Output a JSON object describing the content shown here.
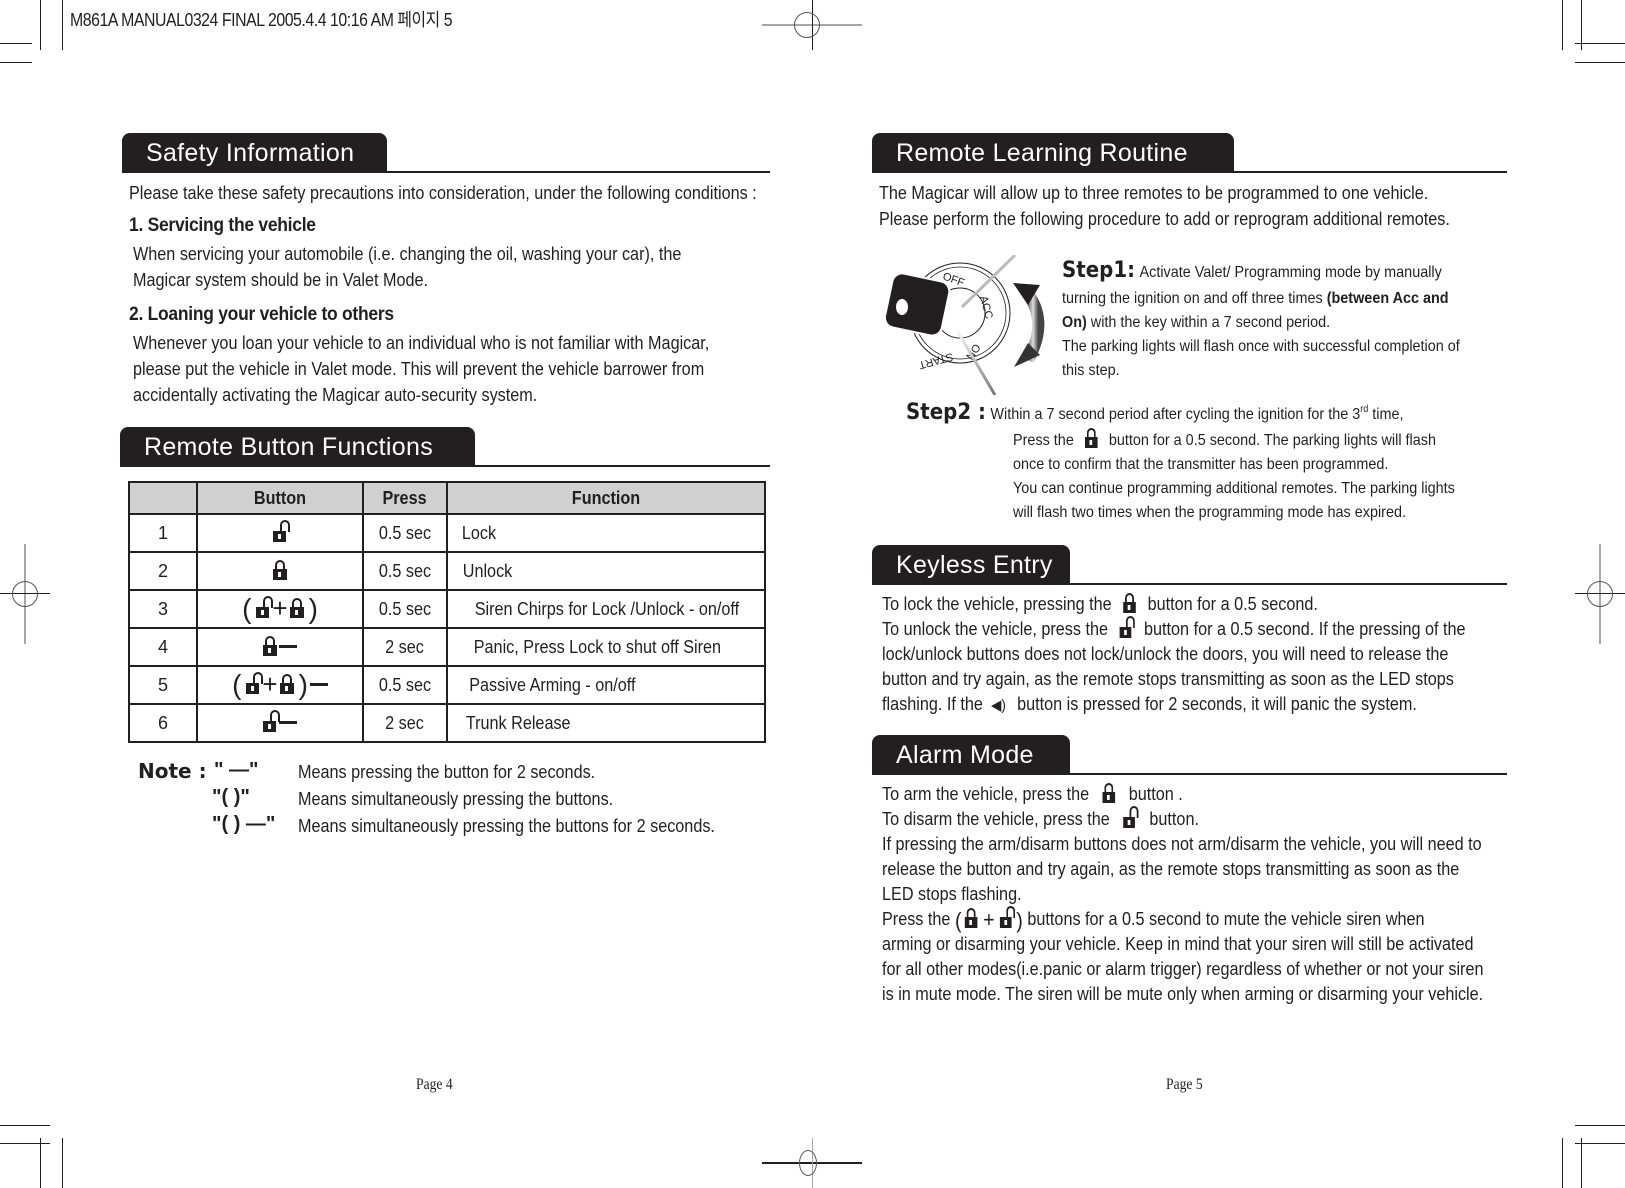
{
  "slug": "M861A MANUAL0324 FINAL  2005.4.4  10:16 AM 페이지 5",
  "left_page": {
    "safety": {
      "title": "Safety Information",
      "intro": "Please take these safety precautions into consideration, under the following conditions :",
      "items": [
        {
          "heading": "1. Servicing the vehicle",
          "lines": [
            "When servicing your automobile (i.e. changing the oil, washing your car), the",
            "Magicar system should be in Valet Mode."
          ]
        },
        {
          "heading": "2. Loaning your vehicle to others",
          "lines": [
            "Whenever you loan your vehicle to an individual who is not familiar with  Magicar,",
            "please put the vehicle in Valet mode.  This will prevent the vehicle barrower from",
            "accidentally activating the  Magicar auto-security system."
          ]
        }
      ]
    },
    "remote_buttons": {
      "title": "Remote Button Functions",
      "columns": [
        "",
        "Button",
        "Press",
        "Function"
      ],
      "rows": [
        {
          "num": "1",
          "button_icons": "unlock-icon",
          "press": "0.5 sec",
          "function": "Lock"
        },
        {
          "num": "2",
          "button_icons": "lock-icon",
          "press": "0.5 sec",
          "function": "Unlock"
        },
        {
          "num": "3",
          "button_icons": "(unlock-icon + lock-icon)",
          "press": "0.5 sec",
          "function": "Siren Chirps for Lock /Unlock - on/off"
        },
        {
          "num": "4",
          "button_icons": "lock-icon —",
          "press": "2 sec",
          "function": "Panic, Press Lock to shut off Siren"
        },
        {
          "num": "5",
          "button_icons": "(unlock-icon + lock-icon) —",
          "press": "0.5 sec",
          "function": "Passive Arming - on/off"
        },
        {
          "num": "6",
          "button_icons": "unlock-icon —",
          "press": "2 sec",
          "function": "Trunk Release"
        }
      ],
      "note_label": "Note :",
      "notes": [
        {
          "symbol": "\" —\"",
          "text": "Means pressing the button for 2 seconds."
        },
        {
          "symbol": "\"(    )\"",
          "text": "Means simultaneously pressing the buttons."
        },
        {
          "symbol": "\"(    ) —\"",
          "text": "Means simultaneously pressing the buttons for 2 seconds."
        }
      ]
    },
    "page_number": "Page 4"
  },
  "right_page": {
    "learning": {
      "title": "Remote Learning Routine",
      "intro": [
        "The Magicar will allow up to three remotes to be programmed to one vehicle.",
        "Please perform the following procedure to add or reprogram additional remotes."
      ],
      "ignition_labels": [
        "OFF",
        "ACC",
        "ON",
        "START"
      ],
      "step1": {
        "label": "Step1:",
        "line1": "Activate Valet/ Programming mode by manually",
        "line2_pre": "turning the ignition on and off three times ",
        "line2_bold": "(between Acc and",
        "line3_bold": "On)",
        "line3_post": " with the key within a 7 second period.",
        "line4": "The parking lights will flash once with successful completion of",
        "line5": "this step."
      },
      "step2": {
        "label": "Step2 :",
        "line1_pre": "Within a 7 second period after cycling the ignition for the 3",
        "line1_sup": "rd",
        "line1_post": " time,",
        "line2_pre": "Press the ",
        "line2_post": " button for a 0.5 second. The parking lights will flash",
        "line3": "once to confirm that the transmitter has been programmed.",
        "line4": "You can continue programming additional remotes.  The parking lights",
        "line5": "will flash two times when the programming mode has expired."
      }
    },
    "keyless": {
      "title": "Keyless  Entry",
      "line1_pre": "To lock the vehicle, pressing the ",
      "line1_post": " button for a 0.5 second.",
      "line2_pre": "To unlock the vehicle, press the ",
      "line2_post": " button for a 0.5 second.  If the pressing of the",
      "line3": "lock/unlock buttons does not lock/unlock the doors, you will need to release the",
      "line4": "button and try again, as the remote stops transmitting as soon as the LED stops",
      "line5_pre": "flashing.  If the ",
      "line5_post": " button is pressed for 2 seconds, it will panic the system."
    },
    "alarm": {
      "title": "Alarm  Mode",
      "line1_pre": "To arm the vehicle, press the ",
      "line1_post": " button .",
      "line2_pre": "To disarm the vehicle, press the ",
      "line2_post": " button.",
      "line3": "If pressing the arm/disarm buttons does not arm/disarm the vehicle, you will need to",
      "line4": "release the button and try again, as the remote stops transmitting as soon as the",
      "line5": "LED stops flashing.",
      "line6_pre": "Press the ",
      "line6_post": " buttons for a 0.5 second to mute the vehicle siren when",
      "line7": "arming or disarming your vehicle.  Keep in mind that your siren will still be activated",
      "line8": "for all other modes(i.e.panic or alarm trigger) regardless of whether or not your siren",
      "line9": "is in mute mode.  The siren will be mute only when arming or disarming your vehicle."
    },
    "page_number": "Page 5"
  }
}
